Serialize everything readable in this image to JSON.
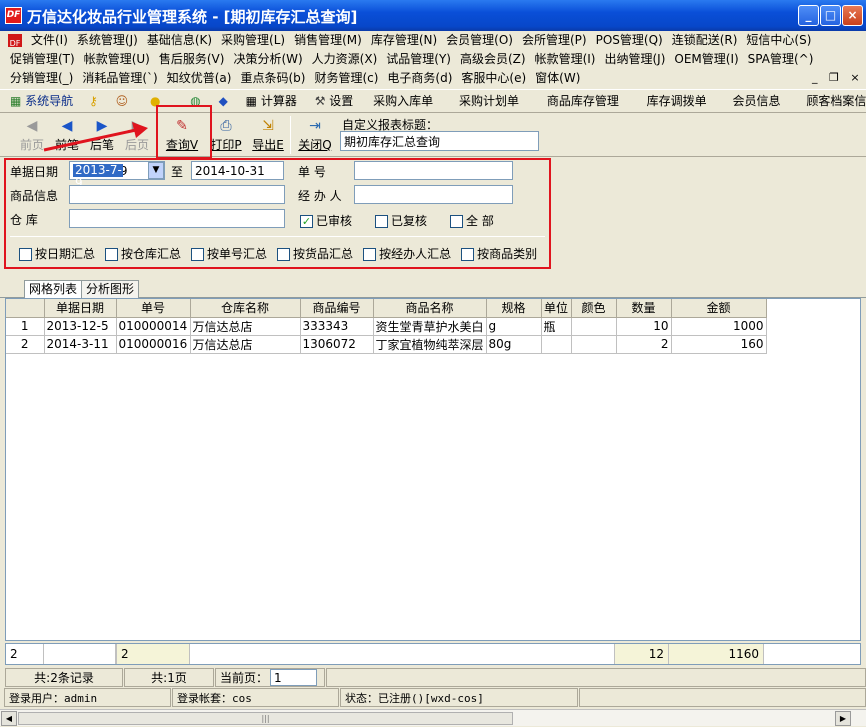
{
  "window": {
    "logo_text": "DF",
    "title": "万信达化妆品行业管理系统 - [期初库存汇总查询]",
    "min": "_",
    "max": "□",
    "close": "×"
  },
  "menu_rows": [
    [
      "文件(I)",
      "系统管理(J)",
      "基础信息(K)",
      "采购管理(L)",
      "销售管理(M)",
      "库存管理(N)",
      "会员管理(O)",
      "会所管理(P)",
      "POS管理(Q)",
      "连锁配送(R)",
      "短信中心(S)"
    ],
    [
      "促销管理(T)",
      "帐款管理(U)",
      "售后服务(V)",
      "决策分析(W)",
      "人力资源(X)",
      "试品管理(Y)",
      "高级会员(Z)",
      "帐款管理(I)",
      "出纳管理(J)",
      "OEM管理(I)",
      "SPA管理(^)"
    ],
    [
      "分销管理(_)",
      "消耗品管理(`)",
      "知纹优普(a)",
      "重点条码(b)",
      "财务管理(c)",
      "电子商务(d)",
      "客服中心(e)",
      "窗体(W)"
    ]
  ],
  "mdi_controls": {
    "min": "_",
    "restore": "❐",
    "close": "×"
  },
  "toolbar1": {
    "nav": "系统导航",
    "calc": "计算器",
    "settings": "设置",
    "links": [
      "采购入库单",
      "采购计划单",
      "商品库存管理",
      "库存调拨单",
      "会员信息",
      "顾客档案信"
    ]
  },
  "toolbar2": {
    "first": "前页",
    "prev": "前笔",
    "next": "后笔",
    "last": "后页",
    "query": "查询V",
    "print": "打印P",
    "export": "导出E",
    "close": "关闭Q",
    "custom_title_label": "自定义报表标题：",
    "custom_title_value": "期初库存汇总查询"
  },
  "filters": {
    "date_label": "单据日期",
    "date_from": "2013-7-9",
    "to_label": "至",
    "date_to": "2014-10-31",
    "docno_label": "单        号",
    "docno_value": "",
    "product_label": "商品信息",
    "product_value": "",
    "handler_label": "经 办 人",
    "handler_value": "",
    "warehouse_label": "仓        库",
    "warehouse_value": "",
    "audited": "已审核",
    "audited_checked": true,
    "reviewed": "已复核",
    "reviewed_checked": false,
    "all": "全  部",
    "all_checked": false,
    "groupings": [
      "按日期汇总",
      "按仓库汇总",
      "按单号汇总",
      "按货品汇总",
      "按经办人汇总",
      "按商品类别"
    ]
  },
  "tabs": [
    "网格列表",
    "分析图形"
  ],
  "table": {
    "columns": [
      "",
      "单据日期",
      "单号",
      "仓库名称",
      "商品编号",
      "商品名称",
      "规格",
      "单位",
      "颜色",
      "数量",
      "金额"
    ],
    "rows": [
      [
        "1",
        "2013-12-5",
        "010000014",
        "万信达总店",
        "333343",
        "资生堂青草护水美白",
        "g",
        "瓶",
        "",
        "10",
        "1000"
      ],
      [
        "2",
        "2014-3-11",
        "010000016",
        "万信达总店",
        "1306072",
        "丁家宜植物纯萃深层",
        "80g",
        "",
        "",
        "2",
        "160"
      ]
    ]
  },
  "footer": {
    "count": "2",
    "docs": "2",
    "qty": "12",
    "amount": "1160"
  },
  "status": {
    "records": "共:2条记录",
    "pages": "共:1页",
    "current_label": "当前页：",
    "current_page": "1",
    "user": "登录用户：admin",
    "account": "登录帐套：cos",
    "state": "状态：已注册()[wxd-cos]"
  },
  "colors": {
    "highlight": "#e0141e",
    "title_blue": "#0a4fd8",
    "arrow": "#e0141e"
  }
}
